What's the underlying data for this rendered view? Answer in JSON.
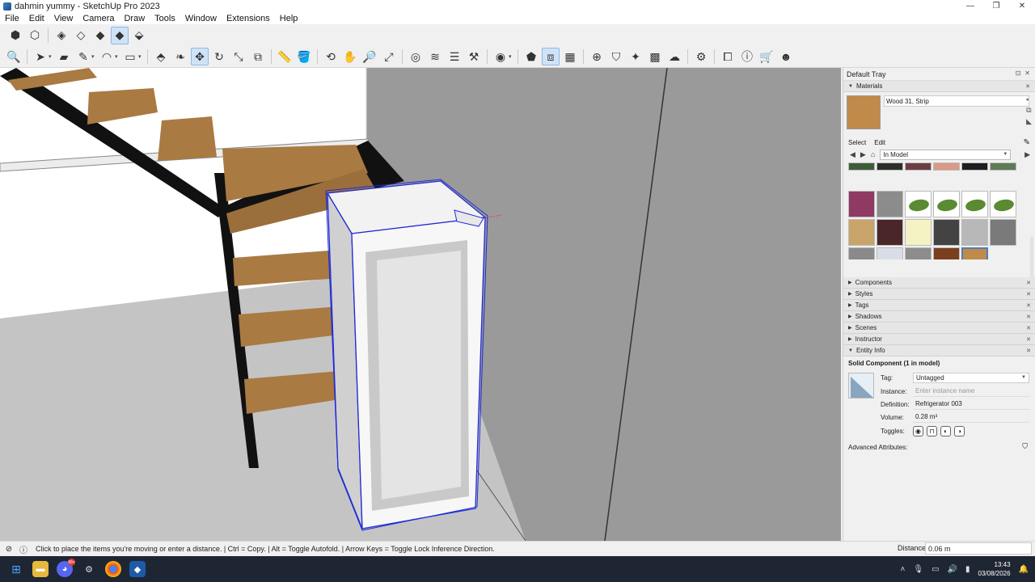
{
  "window": {
    "title": "dahmin yummy - SketchUp Pro 2023",
    "controls": {
      "minimize": "—",
      "maximize": "❐",
      "close": "✕"
    }
  },
  "menu": [
    "File",
    "Edit",
    "View",
    "Camera",
    "Draw",
    "Tools",
    "Window",
    "Extensions",
    "Help"
  ],
  "tray": {
    "title": "Default Tray",
    "materials": {
      "header": "Materials",
      "current_name": "Wood 31, Strip",
      "current_color": "#c08a4a",
      "select_tab": "Select",
      "edit_tab": "Edit",
      "collection": "In Model",
      "swatch_colors": [
        "#3e5c3a",
        "#2b2f2a",
        "#6d3d44",
        "#d99a86",
        "#1e1e1e",
        "#5e7a56",
        "#8e3a62",
        "#8c8c8c",
        "leaf",
        "leaf",
        "leaf",
        "leaf",
        "#c9a46a",
        "#4a2628",
        "#f5f3c4",
        "#434343",
        "#b8b8b8",
        "#7a7a7a",
        "#8a8a8a",
        "#d8dde8",
        "#8d8d8d",
        "#7b3f1f",
        "#c08a4a"
      ],
      "selected_index": 22
    },
    "panels": [
      "Components",
      "Styles",
      "Tags",
      "Shadows",
      "Scenes",
      "Instructor"
    ],
    "entity_info": {
      "header": "Entity Info",
      "heading": "Solid Component (1 in model)",
      "tag_label": "Tag:",
      "tag_value": "Untagged",
      "instance_label": "Instance:",
      "instance_placeholder": "Enter instance name",
      "definition_label": "Definition:",
      "definition_value": "Refrigerator 003",
      "volume_label": "Volume:",
      "volume_value": "0.28 m³",
      "toggles_label": "Toggles:",
      "advanced_label": "Advanced Attributes:"
    }
  },
  "status": {
    "message": "Click to place the items you're moving or enter a distance. | Ctrl = Copy. | Alt = Toggle Autofold. | Arrow Keys = Toggle Lock Inference Direction.",
    "measure_label": "Distance",
    "measure_value": "0.06 m"
  },
  "taskbar": {
    "badge": "99+",
    "time": "13:43",
    "date": "03/08/2026"
  }
}
